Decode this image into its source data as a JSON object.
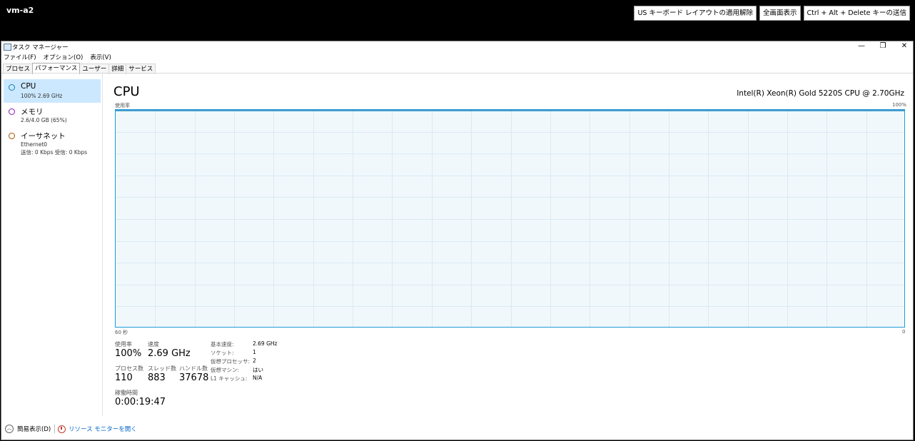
{
  "vm": {
    "name": "vm-a2",
    "buttons": [
      "US キーボード レイアウトの適用解除",
      "全画面表示",
      "Ctrl + Alt + Delete キーの送信"
    ]
  },
  "window": {
    "title": "タスク マネージャー",
    "minimize_glyph": "—",
    "restore_glyph": "❐",
    "close_glyph": "✕"
  },
  "menu": [
    "ファイル(F)",
    "オプション(O)",
    "表示(V)"
  ],
  "tabs": [
    "プロセス",
    "パフォーマンス",
    "ユーザー",
    "詳細",
    "サービス"
  ],
  "active_tab": "パフォーマンス",
  "sidebar": [
    {
      "title": "CPU",
      "sub": "100%  2.69 GHz",
      "color": "#117dbb"
    },
    {
      "title": "メモリ",
      "sub": "2.6/4.0 GB (65%)",
      "color": "#8b12ae"
    },
    {
      "title": "イーサネット",
      "sub": "Ethernet0",
      "sub2": "送信: 0 Kbps 受信: 0 Kbps",
      "color": "#a74f01"
    }
  ],
  "main": {
    "title": "CPU",
    "model": "Intel(R) Xeon(R) Gold 5220S CPU @ 2.70GHz",
    "graph_label_tl": "使用率",
    "graph_label_tr": "100%",
    "graph_label_bl": "60 秒",
    "graph_label_br": "0",
    "usage_percent": 100
  },
  "stats": {
    "usage_label": "使用率",
    "usage_value": "100%",
    "speed_label": "速度",
    "speed_value": "2.69 GHz",
    "proc_label": "プロセス数",
    "proc_value": "110",
    "thread_label": "スレッド数",
    "thread_value": "883",
    "handle_label": "ハンドル数",
    "handle_value": "37678",
    "uptime_label": "稼働時間",
    "uptime_value": "0:00:19:47"
  },
  "details": [
    {
      "label": "基本速度:",
      "value": "2.69 GHz"
    },
    {
      "label": "ソケット:",
      "value": "1"
    },
    {
      "label": "仮想プロセッサ:",
      "value": "2"
    },
    {
      "label": "仮想マシン:",
      "value": "はい"
    },
    {
      "label": "L1 キャッシュ:",
      "value": "N/A"
    }
  ],
  "footer": {
    "fewer_details": "簡易表示(D)",
    "resource_monitor": "リソース モニターを開く"
  }
}
